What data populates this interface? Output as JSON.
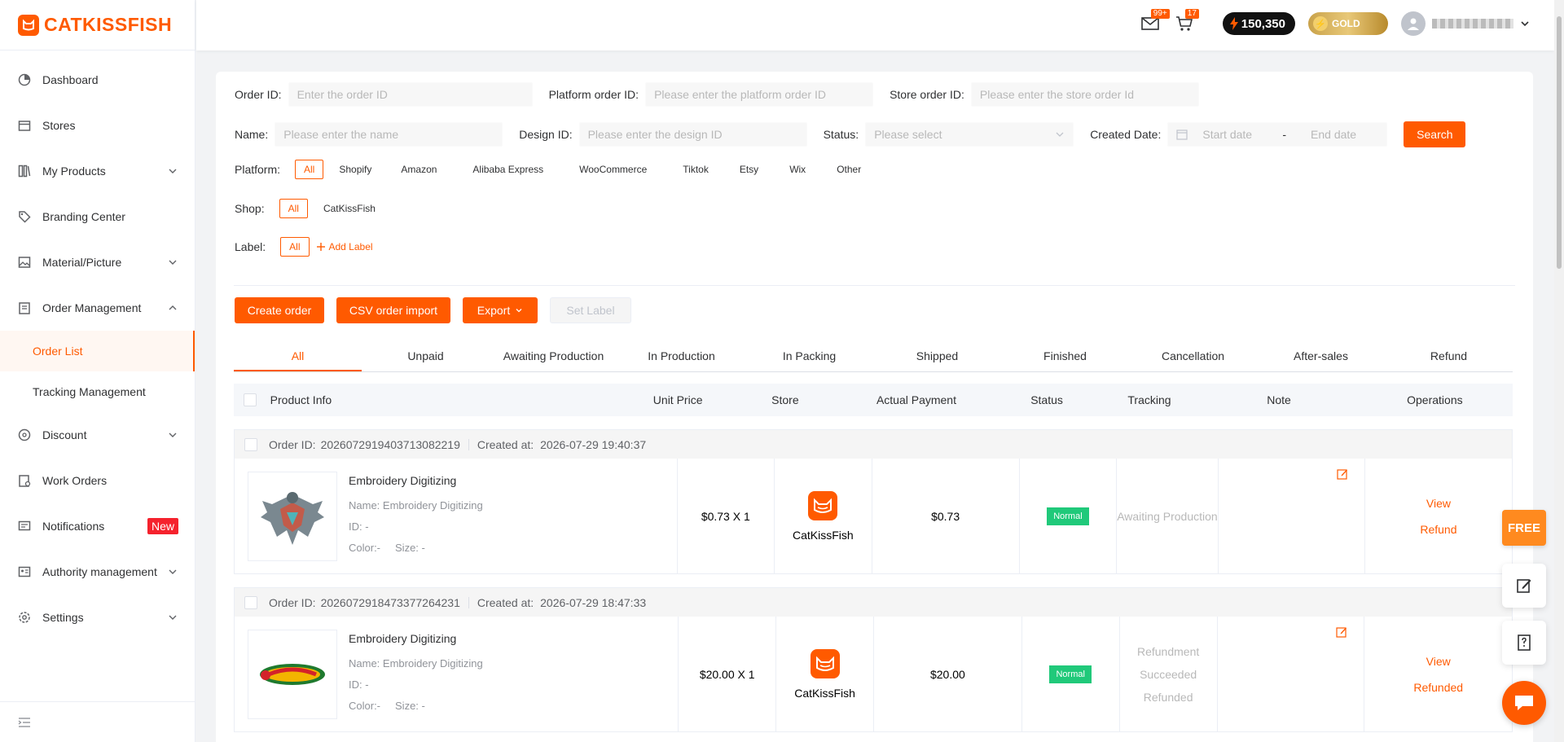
{
  "app": {
    "brand": "CATKISSFISH"
  },
  "sidebar": {
    "items": [
      {
        "label": "Dashboard",
        "icon": "dashboard-icon"
      },
      {
        "label": "Stores",
        "icon": "store-icon"
      },
      {
        "label": "My Products",
        "icon": "products-icon"
      },
      {
        "label": "Branding Center",
        "icon": "tag-icon"
      },
      {
        "label": "Material/Picture",
        "icon": "image-icon"
      },
      {
        "label": "Order Management",
        "icon": "clipboard-icon"
      },
      {
        "label": "Order List"
      },
      {
        "label": "Tracking Management"
      },
      {
        "label": "Discount",
        "icon": "discount-icon"
      },
      {
        "label": "Work Orders",
        "icon": "work-order-icon"
      },
      {
        "label": "Notifications",
        "icon": "message-icon",
        "badge": "New"
      },
      {
        "label": "Authority management",
        "icon": "id-card-icon"
      },
      {
        "label": "Settings",
        "icon": "gear-icon"
      }
    ]
  },
  "header": {
    "mail_count": "99+",
    "cart_count": "17",
    "points": "150,350",
    "tier": "GOLD"
  },
  "filters": {
    "order_id_label": "Order ID:",
    "order_id_placeholder": "Enter the order ID",
    "platform_order_label": "Platform order ID:",
    "platform_order_placeholder": "Please enter the platform order ID",
    "store_order_label": "Store order ID:",
    "store_order_placeholder": "Please enter the store order Id",
    "name_label": "Name:",
    "name_placeholder": "Please enter the name",
    "design_label": "Design ID:",
    "design_placeholder": "Please enter the design ID",
    "status_label": "Status:",
    "status_placeholder": "Please select",
    "date_label": "Created Date:",
    "start_date": "Start date",
    "date_sep": "-",
    "end_date": "End date",
    "search": "Search",
    "platform_label": "Platform:",
    "platforms": [
      "All",
      "Shopify",
      "Amazon",
      "Alibaba Express",
      "WooCommerce",
      "Tiktok",
      "Etsy",
      "Wix",
      "Other"
    ],
    "shop_label": "Shop:",
    "shops": [
      "All",
      "CatKissFish"
    ],
    "label_label": "Label:",
    "labels": [
      "All"
    ],
    "add_label": "Add Label"
  },
  "actions": {
    "create_order": "Create order",
    "csv_import": "CSV order import",
    "export": "Export",
    "set_label": "Set Label"
  },
  "tabs": [
    "All",
    "Unpaid",
    "Awaiting Production",
    "In Production",
    "In Packing",
    "Shipped",
    "Finished",
    "Cancellation",
    "After-sales",
    "Refund"
  ],
  "table": {
    "columns": [
      "Product Info",
      "Unit Price",
      "Store",
      "Actual Payment",
      "Status",
      "Tracking",
      "Note",
      "Operations"
    ]
  },
  "orders": [
    {
      "order_id_label": "Order ID:",
      "order_id": "2026072919403713082219",
      "created_label": "Created at:",
      "created_at": "2026-07-29 19:40:37",
      "product_title": "Embroidery Digitizing",
      "name": "Name: Embroidery Digitizing",
      "id": "ID: -",
      "color": "Color:-",
      "size": "Size:  -",
      "unit_price": "$0.73 X 1",
      "store": "CatKissFish",
      "payment": "$0.73",
      "status": "Normal",
      "tracking": [
        "Awaiting Production"
      ],
      "ops": [
        "View",
        "Refund"
      ]
    },
    {
      "order_id_label": "Order ID:",
      "order_id": "2026072918473377264231",
      "created_label": "Created at:",
      "created_at": "2026-07-29 18:47:33",
      "product_title": "Embroidery Digitizing",
      "name": "Name: Embroidery Digitizing",
      "id": "ID: -",
      "color": "Color:-",
      "size": "Size:  -",
      "unit_price": "$20.00 X 1",
      "store": "CatKissFish",
      "payment": "$20.00",
      "status": "Normal",
      "tracking": [
        "Refundment",
        "Succeeded",
        "Refunded"
      ],
      "ops": [
        "View",
        "Refunded"
      ]
    }
  ],
  "floating": {
    "free": "FREE"
  }
}
